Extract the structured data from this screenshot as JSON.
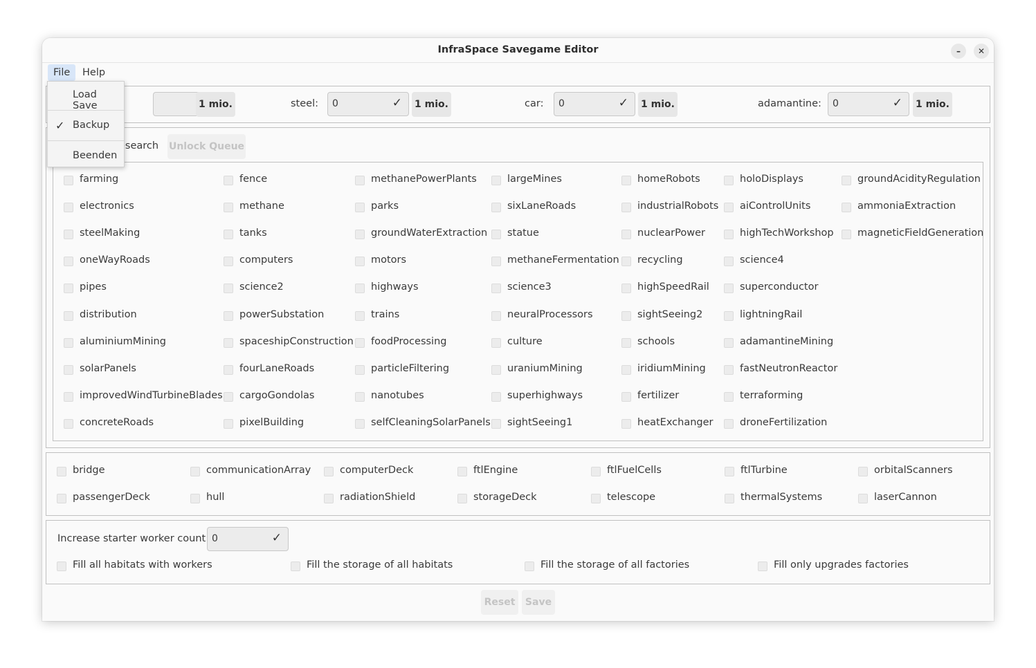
{
  "window": {
    "title": "InfraSpace Savegame Editor",
    "minimize_glyph": "–",
    "close_glyph": "✕"
  },
  "menubar": {
    "file": "File",
    "help": "Help"
  },
  "file_menu": {
    "load_save": "Load Save",
    "backup": "Backup",
    "backup_checked": true,
    "backup_tick": "✓",
    "quit": "Beenden"
  },
  "resources": {
    "check_glyph": "✓",
    "first": {
      "value": "",
      "button": "1 mio."
    },
    "steel": {
      "label": "steel:",
      "value": "0",
      "button": "1 mio."
    },
    "car": {
      "label": "car:",
      "value": "0",
      "button": "1 mio."
    },
    "adamantine": {
      "label": "adamantine:",
      "value": "0",
      "button": "1 mio."
    }
  },
  "research": {
    "partial_label": "esearch",
    "unlock_queue": "Unlock Queue",
    "columns": [
      [
        "farming",
        "electronics",
        "steelMaking",
        "oneWayRoads",
        "pipes",
        "distribution",
        "aluminiumMining",
        "solarPanels",
        "improvedWindTurbineBlades",
        "concreteRoads"
      ],
      [
        "fence",
        "methane",
        "tanks",
        "computers",
        "science2",
        "powerSubstation",
        "spaceshipConstruction",
        "fourLaneRoads",
        "cargoGondolas",
        "pixelBuilding"
      ],
      [
        "methanePowerPlants",
        "parks",
        "groundWaterExtraction",
        "motors",
        "highways",
        "trains",
        "foodProcessing",
        "particleFiltering",
        "nanotubes",
        "selfCleaningSolarPanels"
      ],
      [
        "largeMines",
        "sixLaneRoads",
        "statue",
        "methaneFermentation",
        "science3",
        "neuralProcessors",
        "culture",
        "uraniumMining",
        "superhighways",
        "sightSeeing1"
      ],
      [
        "homeRobots",
        "industrialRobots",
        "nuclearPower",
        "recycling",
        "highSpeedRail",
        "sightSeeing2",
        "schools",
        "iridiumMining",
        "fertilizer",
        "heatExchanger"
      ],
      [
        "holoDisplays",
        "aiControlUnits",
        "highTechWorkshop",
        "science4",
        "superconductor",
        "lightningRail",
        "adamantineMining",
        "fastNeutronReactor",
        "terraforming",
        "droneFertilization"
      ],
      [
        "groundAcidityRegulation",
        "ammoniaExtraction",
        "magneticFieldGeneration"
      ]
    ]
  },
  "spaceship": {
    "rows": [
      [
        "bridge",
        "communicationArray",
        "computerDeck",
        "ftlEngine",
        "ftlFuelCells",
        "ftlTurbine",
        "orbitalScanners"
      ],
      [
        "passengerDeck",
        "hull",
        "radiationShield",
        "storageDeck",
        "telescope",
        "thermalSystems",
        "laserCannon"
      ]
    ]
  },
  "workers": {
    "label": "Increase starter worker count:",
    "value": "0",
    "options": [
      "Fill all habitats with workers",
      "Fill the storage of all habitats",
      "Fill the storage of all factories",
      "Fill only upgrades factories"
    ]
  },
  "footer": {
    "reset": "Reset",
    "save": "Save"
  }
}
